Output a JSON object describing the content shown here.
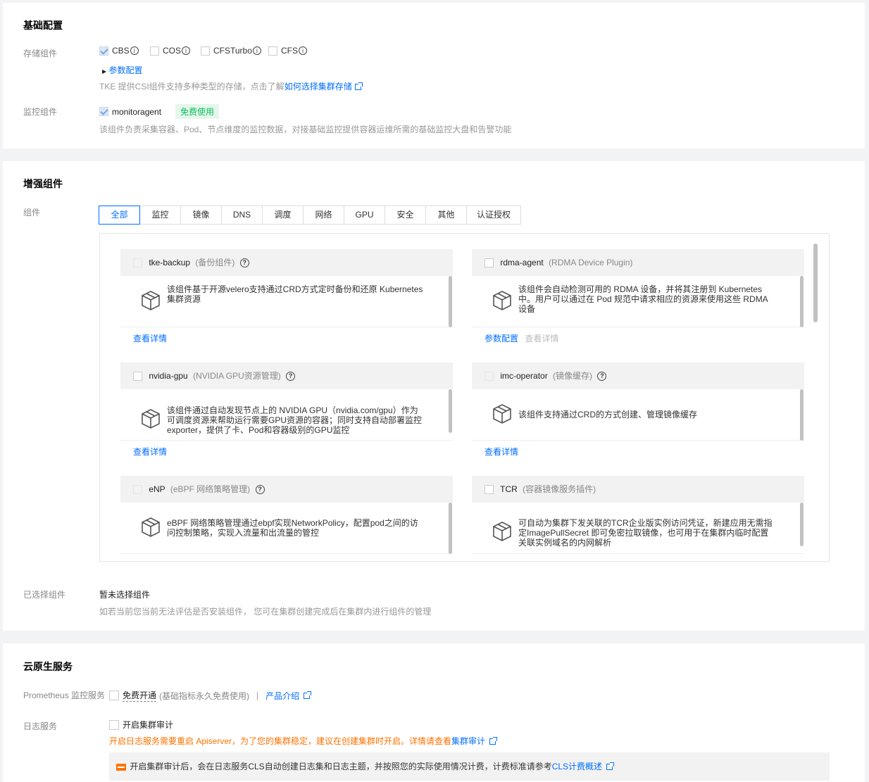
{
  "basic": {
    "title": "基础配置",
    "storage_label": "存储组件",
    "storage_options": [
      "CBS",
      "COS",
      "CFSTurbo",
      "CFS"
    ],
    "param_config": "参数配置",
    "storage_hint_prefix": "TKE 提供CSI组件支持多种类型的存储，点击了解",
    "storage_hint_link": "如何选择集群存储",
    "monitor_label": "监控组件",
    "monitor_option": "monitoragent",
    "free_tag": "免费使用",
    "monitor_hint": "该组件负责采集容器、Pod、节点维度的监控数据，对接基础监控提供容器运维所需的基础监控大盘和告警功能"
  },
  "enhanced": {
    "title": "增强组件",
    "components_label": "组件",
    "tabs": [
      "全部",
      "监控",
      "镜像",
      "DNS",
      "调度",
      "网络",
      "GPU",
      "安全",
      "其他",
      "认证授权"
    ],
    "items": [
      {
        "name": "tke-backup",
        "sub": "(备份组件)",
        "desc": "该组件基于开源velero支持通过CRD方式定时备份和还原 Kubernetes 集群资源",
        "link1": "查看详情"
      },
      {
        "name": "rdma-agent",
        "sub": "(RDMA Device Plugin)",
        "desc": "该组件会自动检测可用的 RDMA 设备，并将其注册到 Kubernetes 中。用户可以通过在 Pod 规范中请求相应的资源来使用这些 RDMA 设备",
        "link1": "参数配置",
        "link2": "查看详情"
      },
      {
        "name": "nvidia-gpu",
        "sub": "(NVIDIA GPU资源管理)",
        "desc": "该组件通过自动发现节点上的 NVIDIA GPU（nvidia.com/gpu）作为可调度资源来帮助运行需要GPU资源的容器；同时支持自动部署监控exporter，提供了卡、Pod和容器级别的GPU监控",
        "link1": "查看详情"
      },
      {
        "name": "imc-operator",
        "sub": "(镜像缓存)",
        "desc": "该组件支持通过CRD的方式创建、管理镜像缓存",
        "link1": "查看详情"
      },
      {
        "name": "eNP",
        "sub": "(eBPF 网络策略管理)",
        "desc": "eBPF 网络策略管理通过ebpf实现NetworkPolicy，配置pod之间的访问控制策略，实现入流量和出流量的管控"
      },
      {
        "name": "TCR",
        "sub": "(容器镜像服务插件)",
        "desc": "可自动为集群下发关联的TCR企业版实例访问凭证，新建应用无需指定ImagePullSecret 即可免密拉取镜像，也可用于在集群内临时配置关联实例域名的内网解析"
      }
    ],
    "selected_label": "已选择组件",
    "selected_value": "暂未选择组件",
    "selected_hint": "如若当前您当前无法评估是否安装组件， 您可在集群创建完成后在集群内进行组件的管理"
  },
  "cloud": {
    "title": "云原生服务",
    "prom_label": "Prometheus 监控服务",
    "prom_option": "免费开通",
    "prom_note": "(基础指标永久免费使用)",
    "prom_sep": "|",
    "prom_link": "产品介绍",
    "log_label": "日志服务",
    "log_option": "开启集群审计",
    "log_warning": "开启日志服务需要重启 Apiserver，为了您的集群稳定，建议在创建集群时开启。详情请查看",
    "log_warning_link": "集群审计",
    "notice_text": "开启集群审计后，会在日志服务CLS自动创建日志集和日志主题，并按照您的实际使用情况计费，计费标准请参考",
    "notice_link": "CLS计费概述"
  }
}
